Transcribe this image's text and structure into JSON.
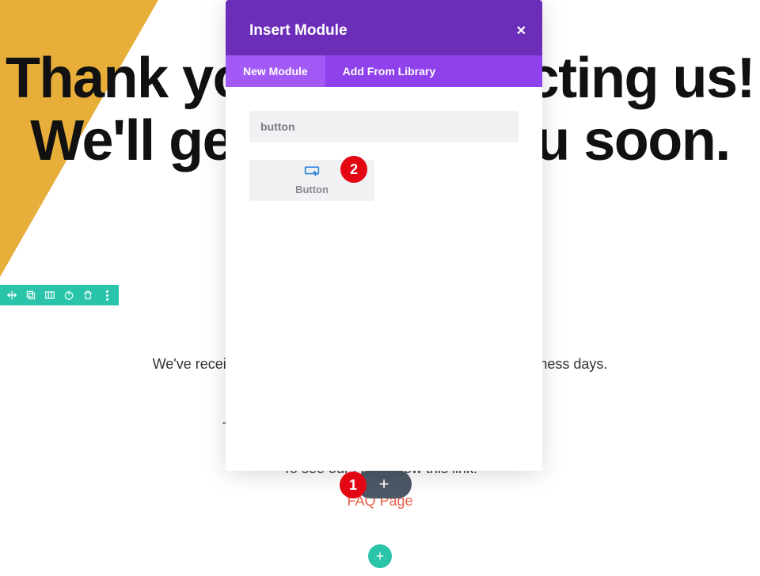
{
  "hero": {
    "line1": "Thank you for contacting us!",
    "line2": "We'll get back to you soon."
  },
  "content": {
    "p1": "We've received your message and we'll respond within 2 business days.",
    "p2": "This is an idea of a few questions you might have.",
    "p3": "To see our FAQ follow this link:",
    "link_label": "FAQ Page"
  },
  "modal": {
    "title": "Insert Module",
    "tabs": {
      "new": "New Module",
      "lib": "Add From Library"
    },
    "search_value": "button",
    "results": [
      {
        "label": "Button",
        "icon": "button"
      }
    ]
  },
  "badges": {
    "b1": "1",
    "b2": "2"
  },
  "buttons": {
    "add_pill": "+",
    "add_circle": "+"
  }
}
